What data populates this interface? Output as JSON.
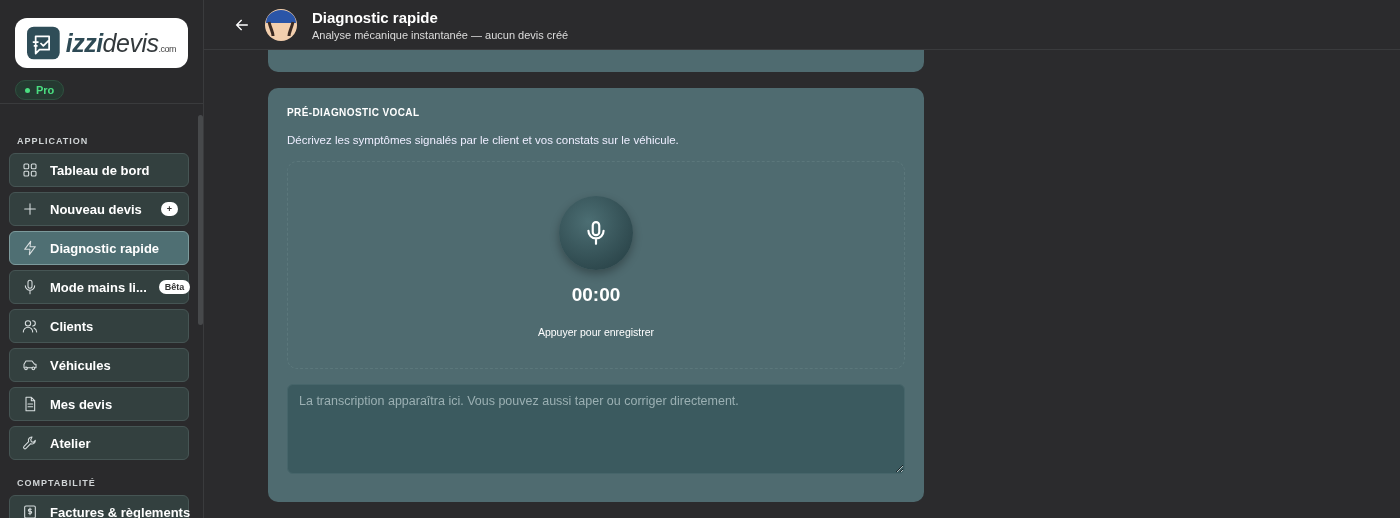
{
  "sidebar": {
    "logo": {
      "brand_1": "izzi",
      "brand_2": "devis",
      "suffix": ".com"
    },
    "plan_badge": "Pro",
    "sections": [
      {
        "title": "APPLICATION",
        "items": [
          {
            "label": "Tableau de bord",
            "selected": false
          },
          {
            "label": "Nouveau devis",
            "selected": false,
            "badge": "+"
          },
          {
            "label": "Diagnostic rapide",
            "selected": true
          },
          {
            "label": "Mode mains li...",
            "selected": false,
            "badge": "Bêta"
          },
          {
            "label": "Clients",
            "selected": false
          },
          {
            "label": "Véhicules",
            "selected": false
          },
          {
            "label": "Mes devis",
            "selected": false
          },
          {
            "label": "Atelier",
            "selected": false
          }
        ]
      },
      {
        "title": "COMPTABILITÉ",
        "items": [
          {
            "label": "Factures & règlements",
            "selected": false
          }
        ]
      }
    ]
  },
  "header": {
    "title": "Diagnostic rapide",
    "subtitle": "Analyse mécanique instantanée — aucun devis créé"
  },
  "card": {
    "title": "PRÉ-DIAGNOSTIC VOCAL",
    "description": "Décrivez les symptômes signalés par le client et vos constats sur le véhicule.",
    "timer": "00:00",
    "hint": "Appuyer pour enregistrer",
    "placeholder": "La transcription apparaîtra ici. Vous pouvez aussi taper ou corriger directement."
  }
}
